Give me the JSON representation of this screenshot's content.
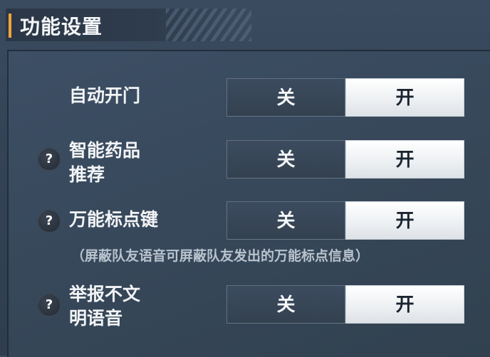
{
  "header": {
    "title": "功能设置"
  },
  "settings": [
    {
      "label_lines": [
        "自动开门"
      ],
      "has_help": false,
      "off_label": "关",
      "on_label": "开",
      "selected": "开"
    },
    {
      "label_lines": [
        "智能药品",
        "推荐"
      ],
      "has_help": true,
      "off_label": "关",
      "on_label": "开",
      "selected": "开"
    },
    {
      "label_lines": [
        "万能标点键"
      ],
      "has_help": true,
      "off_label": "关",
      "on_label": "开",
      "selected": "开",
      "note": "（屏蔽队友语音可屏蔽队友发出的万能标点信息）"
    },
    {
      "label_lines": [
        "举报不文",
        "明语音"
      ],
      "has_help": true,
      "off_label": "关",
      "on_label": "开",
      "selected": "开"
    }
  ],
  "help_icon_text": "?",
  "colors": {
    "accent": "#f0a53a",
    "selected_bg": "#ffffff",
    "unselected_bg": "#374657"
  }
}
